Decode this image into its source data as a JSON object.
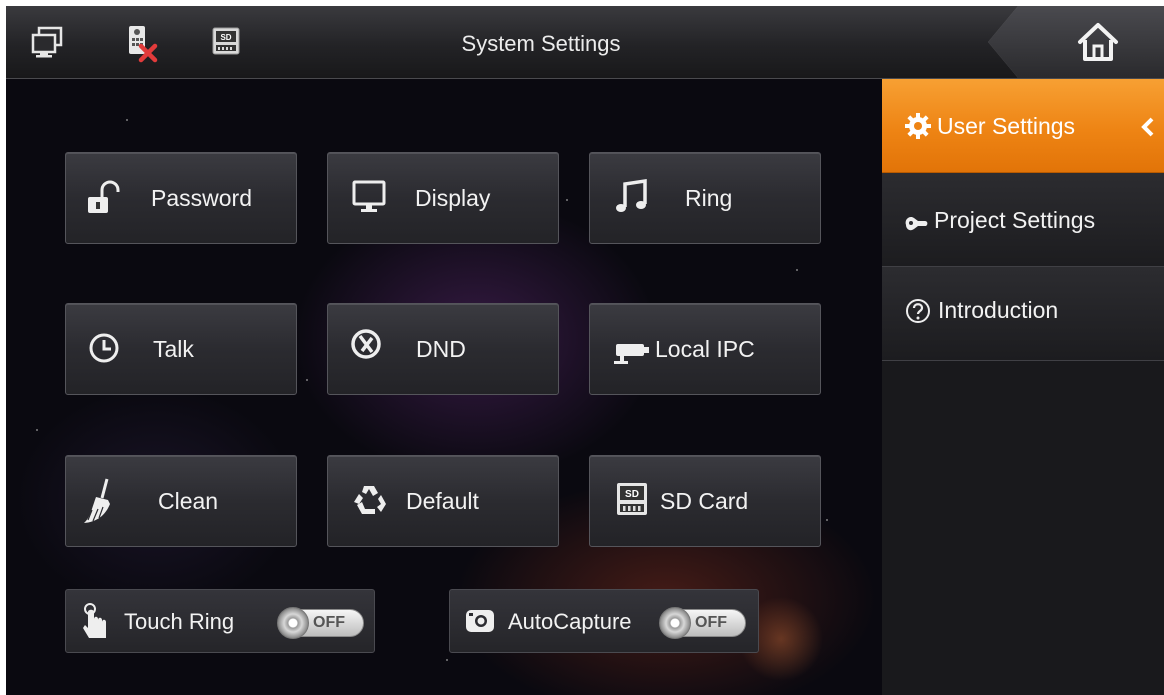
{
  "header": {
    "title": "System Settings",
    "icons": [
      "monitor-icon",
      "intercom-disconnected-icon",
      "sd-card-icon"
    ],
    "home_icon": "home-icon"
  },
  "tiles": [
    {
      "label": "Password",
      "icon": "padlock-open-icon"
    },
    {
      "label": "Display",
      "icon": "monitor-icon"
    },
    {
      "label": "Ring",
      "icon": "music-note-icon"
    },
    {
      "label": "Talk",
      "icon": "clock-icon"
    },
    {
      "label": "DND",
      "icon": "do-not-disturb-icon"
    },
    {
      "label": "Local IPC",
      "icon": "camera-icon"
    },
    {
      "label": "Clean",
      "icon": "broom-icon"
    },
    {
      "label": "Default",
      "icon": "recycle-icon"
    },
    {
      "label": "SD Card",
      "icon": "sd-card-icon"
    }
  ],
  "toggles": [
    {
      "label": "Touch Ring",
      "state": "OFF",
      "icon": "touch-hand-icon"
    },
    {
      "label": "AutoCapture",
      "state": "OFF",
      "icon": "camera-icon"
    }
  ],
  "sidebar": {
    "items": [
      {
        "label": "User Settings",
        "icon": "gear-icon",
        "active": true
      },
      {
        "label": "Project Settings",
        "icon": "wrench-icon",
        "active": false
      },
      {
        "label": "Introduction",
        "icon": "help-icon",
        "active": false
      }
    ]
  },
  "colors": {
    "accent": "#ee8414",
    "topbar": "#2a2a2d",
    "tile": "#2f2f34",
    "text": "#f2f2f2"
  }
}
